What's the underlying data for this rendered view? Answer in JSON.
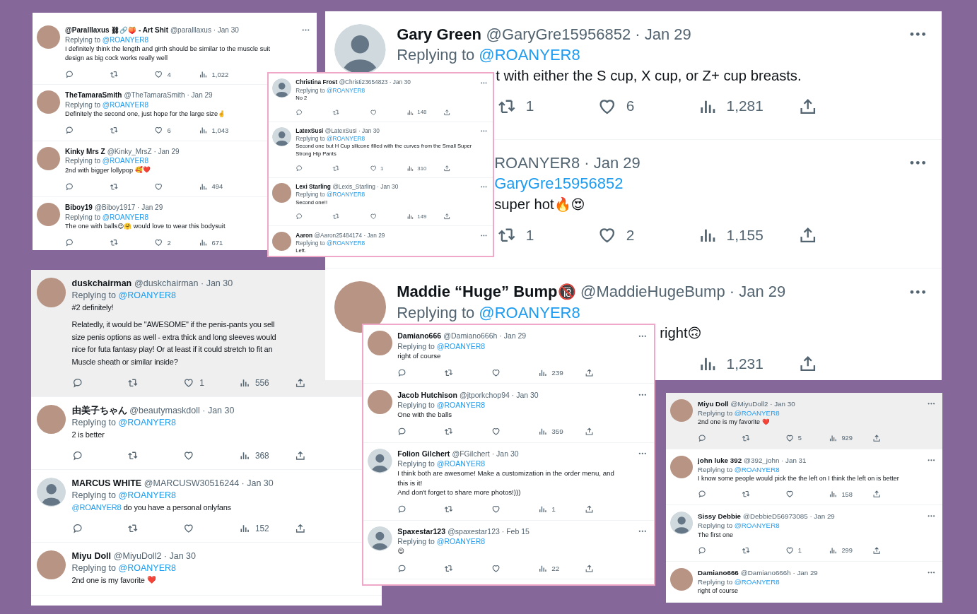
{
  "panels": [
    {
      "tweets": [
        {
          "photo_avatar": true,
          "highlighted": false,
          "name": "@Paralllaxus ⛓🔗🍑 - Art Shit",
          "meta": "@paralllaxus · Jan 30",
          "replying": {
            "prefix": "Replying to",
            "mention": "@ROANYER8"
          },
          "body": [
            [
              "I definitely think the length and girth should be similar to the muscle suit",
              "design as big cock works really well"
            ]
          ],
          "actions": [
            {
              "kind": "reply"
            },
            {
              "kind": "retweet"
            },
            {
              "kind": "like",
              "count": "4"
            },
            {
              "kind": "views",
              "count": "1,022"
            }
          ]
        },
        {
          "photo_avatar": true,
          "highlighted": false,
          "name": "TheTamaraSmith",
          "meta": "@TheTamaraSmith · Jan 29",
          "replying": {
            "prefix": "Replying to",
            "mention": "@ROANYER8"
          },
          "body": [
            [
              "Definitely the second one, just hope for the large size🤞"
            ]
          ],
          "actions": [
            {
              "kind": "reply"
            },
            {
              "kind": "retweet"
            },
            {
              "kind": "like",
              "count": "6"
            },
            {
              "kind": "views",
              "count": "1,043"
            }
          ]
        },
        {
          "photo_avatar": true,
          "highlighted": false,
          "name": "Kinky Mrs Z",
          "meta": "@Kinky_MrsZ · Jan 29",
          "replying": {
            "prefix": "Replying to",
            "mention": "@ROANYER8"
          },
          "body": [
            [
              "2nd with bigger lollypop 🥰❤️"
            ]
          ],
          "actions": [
            {
              "kind": "reply"
            },
            {
              "kind": "retweet"
            },
            {
              "kind": "like"
            },
            {
              "kind": "views",
              "count": "494"
            }
          ]
        },
        {
          "photo_avatar": true,
          "highlighted": false,
          "name": "Biboy19",
          "meta": "@Biboy1917 · Jan 29",
          "replying": {
            "prefix": "Replying to",
            "mention": "@ROANYER8"
          },
          "body": [
            [
              "The one with balls😍🤗 would love to wear this bodysuit"
            ]
          ],
          "actions": [
            {
              "kind": "reply"
            },
            {
              "kind": "retweet"
            },
            {
              "kind": "like",
              "count": "2"
            },
            {
              "kind": "views",
              "count": "671"
            }
          ]
        }
      ]
    },
    {
      "tweets": [
        {
          "photo_avatar": false,
          "highlighted": false,
          "name": "Gary Green",
          "meta": "@GaryGre15956852 · Jan 29",
          "replying": {
            "prefix": "Replying to",
            "mention": "@ROANYER8"
          },
          "body": [
            [
              "t with either the S cup, X cup, or Z+ cup breasts."
            ]
          ],
          "actions": [
            {
              "kind": "retweet",
              "count": "1"
            },
            {
              "kind": "like",
              "count": "6"
            },
            {
              "kind": "views",
              "count": "1,281"
            },
            {
              "kind": "share"
            }
          ]
        },
        {
          "highlighted": false,
          "meta": "ROANYER8 · Jan 29",
          "replying": {
            "mention": "GaryGre15956852"
          },
          "body": [
            [
              "super hot🔥😍"
            ]
          ],
          "actions": [
            {
              "kind": "retweet",
              "count": "1"
            },
            {
              "kind": "like",
              "count": "2"
            },
            {
              "kind": "views",
              "count": "1,155"
            },
            {
              "kind": "share"
            }
          ]
        },
        {
          "photo_avatar": true,
          "highlighted": false,
          "name": "Maddie “Huge” Bump🔞",
          "meta": "@MaddieHugeBump · Jan 29",
          "replying": {
            "prefix": "Replying to",
            "mention": "@ROANYER8"
          },
          "body": [
            [
              "right🙃"
            ]
          ],
          "actions": [
            {
              "kind": "views",
              "count": "1,231"
            },
            {
              "kind": "share"
            }
          ]
        }
      ]
    },
    {
      "tweets": [
        {
          "photo_avatar": false,
          "highlighted": false,
          "name": "Christina Frost",
          "meta": "@Christi23654823 · Jan 30",
          "replying": {
            "prefix": "Replying to",
            "mention": "@ROANYER8"
          },
          "body": [
            [
              "No 2"
            ]
          ],
          "actions": [
            {
              "kind": "reply"
            },
            {
              "kind": "retweet"
            },
            {
              "kind": "like"
            },
            {
              "kind": "views",
              "count": "148"
            },
            {
              "kind": "share"
            }
          ]
        },
        {
          "photo_avatar": false,
          "highlighted": false,
          "name": "LatexSusi",
          "meta": "@LatexSusi · Jan 30",
          "replying": {
            "prefix": "Replying to",
            "mention": "@ROANYER8"
          },
          "body": [
            [
              "Second one but H Cup silicone filled with the curves from the Small Super",
              "Strong Hip Pants"
            ]
          ],
          "actions": [
            {
              "kind": "reply"
            },
            {
              "kind": "retweet"
            },
            {
              "kind": "like",
              "count": "1"
            },
            {
              "kind": "views",
              "count": "310"
            },
            {
              "kind": "share"
            }
          ]
        },
        {
          "photo_avatar": true,
          "highlighted": false,
          "name": "Lexi Starling",
          "meta": "@Lexis_Starling · Jan 30",
          "replying": {
            "prefix": "Replying to",
            "mention": "@ROANYER8"
          },
          "body": [
            [
              "Second one!!"
            ]
          ],
          "actions": [
            {
              "kind": "reply"
            },
            {
              "kind": "retweet"
            },
            {
              "kind": "like"
            },
            {
              "kind": "views",
              "count": "149"
            },
            {
              "kind": "share"
            }
          ]
        },
        {
          "photo_avatar": true,
          "highlighted": false,
          "name": "Aaron",
          "meta": "@Aaron25484174 · Jan 29",
          "replying": {
            "prefix": "Replying to",
            "mention": "@ROANYER8"
          },
          "body": [
            [
              "Left."
            ]
          ]
        }
      ]
    },
    {
      "tweets": [
        {
          "photo_avatar": true,
          "highlighted": true,
          "name": "duskchairman",
          "meta": "@duskchairman · Jan 30",
          "replying": {
            "prefix": "Replying to",
            "mention": "@ROANYER8"
          },
          "body": [
            [
              "#2 definitely!"
            ],
            [
              "Relatedly, it would be \"AWESOME\" if the penis-pants you sell",
              "size penis options as well - extra thick and long sleeves would",
              "nice for futa fantasy play! Or at least if it could stretch to fit an",
              "Muscle sheath or similar inside?"
            ]
          ],
          "actions": [
            {
              "kind": "reply"
            },
            {
              "kind": "retweet"
            },
            {
              "kind": "like",
              "count": "1"
            },
            {
              "kind": "views",
              "count": "556"
            },
            {
              "kind": "share"
            }
          ]
        },
        {
          "photo_avatar": true,
          "highlighted": false,
          "name": "由美子ちゃん",
          "meta": "@beautymaskdoll · Jan 30",
          "replying": {
            "prefix": "Replying to",
            "mention": "@ROANYER8"
          },
          "body": [
            [
              "2 is better"
            ]
          ],
          "actions": [
            {
              "kind": "reply"
            },
            {
              "kind": "retweet"
            },
            {
              "kind": "like"
            },
            {
              "kind": "views",
              "count": "368"
            },
            {
              "kind": "share"
            }
          ]
        },
        {
          "photo_avatar": false,
          "highlighted": false,
          "name": "MARCUS WHITE",
          "meta": "@MARCUSW30516244 · Jan 30",
          "replying": {
            "prefix": "Replying to",
            "mention": "@ROANYER8"
          },
          "body_mention": "@ROANYER8",
          "body": [
            [
              "do you have a personal onlyfans"
            ]
          ],
          "actions": [
            {
              "kind": "reply"
            },
            {
              "kind": "retweet"
            },
            {
              "kind": "like"
            },
            {
              "kind": "views",
              "count": "152"
            },
            {
              "kind": "share"
            }
          ]
        },
        {
          "photo_avatar": true,
          "highlighted": false,
          "name": "Miyu Doll",
          "meta": "@MiyuDoll2 · Jan 30",
          "replying": {
            "prefix": "Replying to",
            "mention": "@ROANYER8"
          },
          "body": [
            [
              "2nd one is my favorite ❤️"
            ]
          ]
        }
      ]
    },
    {
      "tweets": [
        {
          "photo_avatar": true,
          "highlighted": false,
          "name": "Damiano666",
          "meta": "@Damiano666h · Jan 29",
          "replying": {
            "prefix": "Replying to",
            "mention": "@ROANYER8"
          },
          "body": [
            [
              "right of course"
            ]
          ],
          "actions": [
            {
              "kind": "reply"
            },
            {
              "kind": "retweet"
            },
            {
              "kind": "like"
            },
            {
              "kind": "views",
              "count": "239"
            },
            {
              "kind": "share"
            }
          ]
        },
        {
          "photo_avatar": true,
          "highlighted": false,
          "name": "Jacob Hutchison",
          "meta": "@jtporkchop94 · Jan 30",
          "replying": {
            "prefix": "Replying to",
            "mention": "@ROANYER8"
          },
          "body": [
            [
              "One with the balls"
            ]
          ],
          "actions": [
            {
              "kind": "reply"
            },
            {
              "kind": "retweet"
            },
            {
              "kind": "like"
            },
            {
              "kind": "views",
              "count": "359"
            },
            {
              "kind": "share"
            }
          ]
        },
        {
          "photo_avatar": false,
          "highlighted": false,
          "name": "Folion Gilchert",
          "meta": "@FGilchert · Jan 30",
          "replying": {
            "prefix": "Replying to",
            "mention": "@ROANYER8"
          },
          "body": [
            [
              "I think both are awesome! Make a customization in the order menu, and",
              "this is it!",
              "And don't forget to share more photos!)))"
            ]
          ],
          "actions": [
            {
              "kind": "reply"
            },
            {
              "kind": "retweet"
            },
            {
              "kind": "like"
            },
            {
              "kind": "views",
              "count": "1"
            },
            {
              "kind": "share"
            }
          ]
        },
        {
          "photo_avatar": false,
          "highlighted": false,
          "name": "Spaxestar123",
          "meta": "@spaxestar123 · Feb 15",
          "replying": {
            "prefix": "Replying to",
            "mention": "@ROANYER8"
          },
          "body": [
            [
              "😍"
            ]
          ],
          "actions": [
            {
              "kind": "reply"
            },
            {
              "kind": "retweet"
            },
            {
              "kind": "like"
            },
            {
              "kind": "views",
              "count": "22"
            },
            {
              "kind": "share"
            }
          ]
        }
      ]
    },
    {
      "tweets": [
        {
          "photo_avatar": true,
          "highlighted": true,
          "name": "Miyu Doll",
          "meta": "@MiyuDoll2 · Jan 30",
          "replying": {
            "prefix": "Replying to",
            "mention": "@ROANYER8"
          },
          "body": [
            [
              "2nd one is my favorite ❤️"
            ]
          ],
          "actions": [
            {
              "kind": "reply"
            },
            {
              "kind": "retweet"
            },
            {
              "kind": "like",
              "count": "5"
            },
            {
              "kind": "views",
              "count": "929"
            },
            {
              "kind": "share"
            }
          ]
        },
        {
          "photo_avatar": true,
          "highlighted": false,
          "name": "john luke 392",
          "meta": "@392_john · Jan 31",
          "replying": {
            "prefix": "Replying to",
            "mention": "@ROANYER8"
          },
          "body": [
            [
              "I know some people would pick the the left on I think the left on is better"
            ]
          ],
          "actions": [
            {
              "kind": "reply"
            },
            {
              "kind": "retweet"
            },
            {
              "kind": "like"
            },
            {
              "kind": "views",
              "count": "158"
            },
            {
              "kind": "share"
            }
          ]
        },
        {
          "photo_avatar": false,
          "highlighted": false,
          "name": "Sissy Debbie",
          "meta": "@DebbieD56973085 · Jan 29",
          "replying": {
            "prefix": "Replying to",
            "mention": "@ROANYER8"
          },
          "body": [
            [
              "The first one"
            ]
          ],
          "actions": [
            {
              "kind": "reply"
            },
            {
              "kind": "retweet"
            },
            {
              "kind": "like",
              "count": "1"
            },
            {
              "kind": "views",
              "count": "299"
            },
            {
              "kind": "share"
            }
          ]
        },
        {
          "photo_avatar": true,
          "highlighted": false,
          "name": "Damiano666",
          "meta": "@Damiano666h · Jan 29",
          "replying": {
            "prefix": "Replying to",
            "mention": "@ROANYER8"
          },
          "body": [
            [
              "right of course"
            ]
          ]
        }
      ]
    }
  ]
}
